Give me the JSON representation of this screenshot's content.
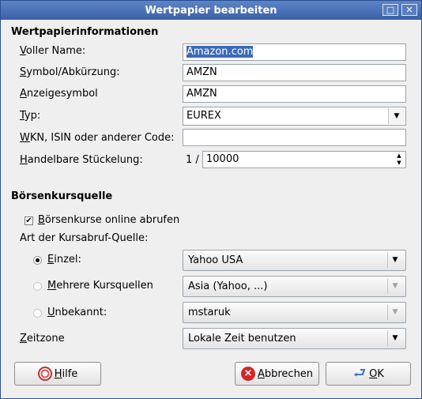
{
  "window": {
    "title": "Wertpapier bearbeiten",
    "buttons": {
      "minimize": "□",
      "close": "✕"
    }
  },
  "security_info": {
    "heading": "Wertpapierinformationen",
    "full_name": {
      "label_mnemonic": "V",
      "label_rest": "oller Name:",
      "value": "Amazon.com"
    },
    "symbol": {
      "label_mnemonic": "S",
      "label_rest": "ymbol/Abkürzung:",
      "value": "AMZN"
    },
    "display_symbol": {
      "label_mnemonic": "A",
      "label_rest": "nzeigesymbol",
      "value": "AMZN"
    },
    "type": {
      "label_mnemonic": "T",
      "label_rest": "yp:",
      "value": "EUREX"
    },
    "code": {
      "label_mnemonic": "W",
      "label_rest": "KN, ISIN oder anderer Code:",
      "value": ""
    },
    "lot": {
      "label_mnemonic": "H",
      "label_rest": "andelbare Stückelung:",
      "prefix": "1 /",
      "value": "10000"
    }
  },
  "quote_source": {
    "heading": "Börsenkursquelle",
    "online": {
      "label_mnemonic": "B",
      "label_rest": "örsenkurse online abrufen",
      "checked": true
    },
    "source_type_label": "Art der Kursabruf-Quelle:",
    "single": {
      "label_mnemonic": "E",
      "label_rest": "inzel:",
      "value": "Yahoo USA",
      "selected": true
    },
    "multiple": {
      "label_mnemonic": "M",
      "label_rest": "ehrere Kursquellen",
      "value": "Asia (Yahoo, ...)",
      "selected": false
    },
    "unknown": {
      "label_mnemonic": "U",
      "label_rest": "nbekannt:",
      "value": "mstaruk",
      "selected": false
    },
    "timezone": {
      "label_mnemonic": "Z",
      "label_rest": "eitzone",
      "value": "Lokale Zeit benutzen"
    }
  },
  "actions": {
    "help": {
      "mnemonic": "H",
      "rest": "ilfe"
    },
    "cancel": {
      "mnemonic": "A",
      "rest": "bbrechen"
    },
    "ok": {
      "mnemonic": "O",
      "rest": "K"
    }
  }
}
